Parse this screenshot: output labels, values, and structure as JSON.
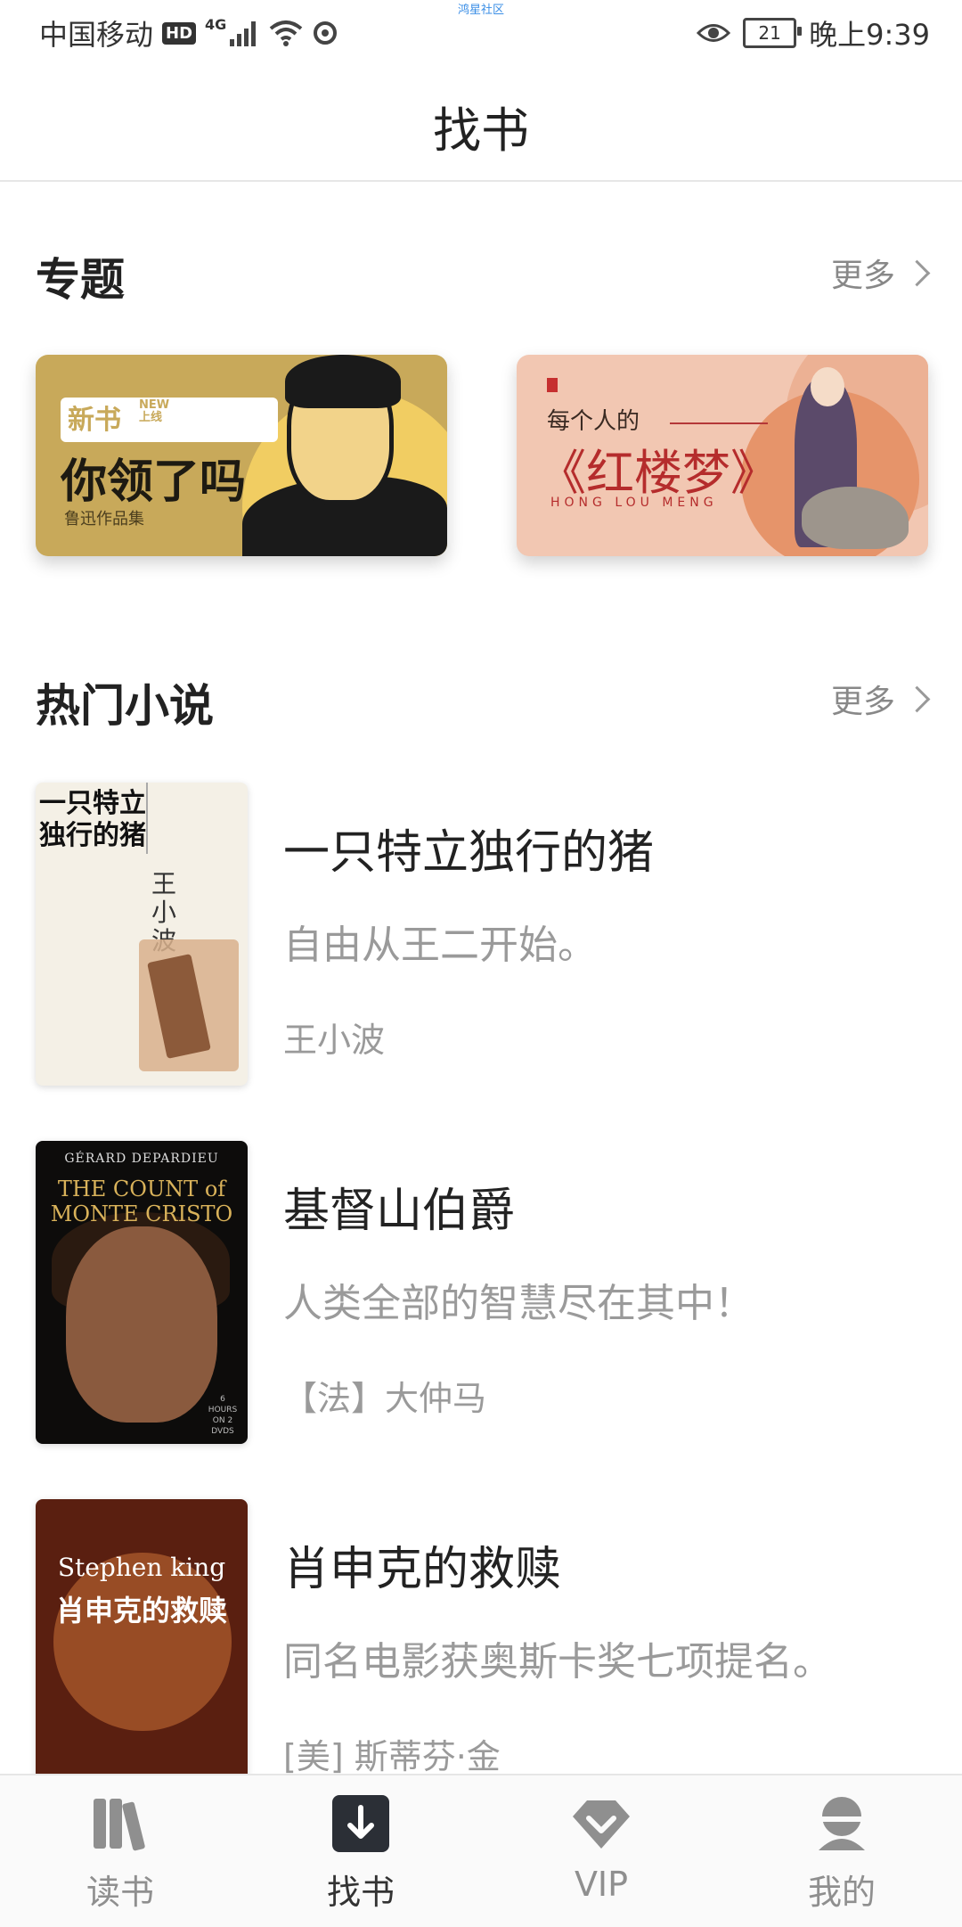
{
  "status_bar": {
    "carrier": "中国移动",
    "hd": "HD",
    "network": "4G",
    "center_text": "鸿星社区",
    "battery": "21",
    "time": "晚上9:39"
  },
  "header": {
    "title": "找书"
  },
  "topics": {
    "title": "专题",
    "more": "更多",
    "banners": [
      {
        "tag_big": "新书",
        "tag_small": "NEW\n上线",
        "main": "你领了吗",
        "sub": "鲁迅作品集"
      },
      {
        "line1": "每个人的",
        "main": "《红楼梦》",
        "pinyin": "HONG LOU MENG"
      }
    ]
  },
  "hot": {
    "title": "热门小说",
    "more": "更多",
    "books": [
      {
        "title": "一只特立独行的猪",
        "desc": "自由从王二开始。",
        "author": "王小波",
        "cover": {
          "title": "一只特立独行的猪",
          "author": "王小波"
        }
      },
      {
        "title": "基督山伯爵",
        "desc": "人类全部的智慧尽在其中！",
        "author": "【法】大仲马",
        "cover": {
          "name": "GÉRARD DEPARDIEU",
          "title": "THE COUNT of MONTE CRISTO",
          "foot": "6 HOURS ON 2 DVDS"
        }
      },
      {
        "title": "肖申克的救赎",
        "desc": "同名电影获奥斯卡奖七项提名。",
        "author": "[美] 斯蒂芬·金",
        "cover": {
          "author": "Stephen king",
          "title": "肖申克的救赎"
        }
      }
    ]
  },
  "nav": {
    "items": [
      {
        "label": "读书",
        "icon": "bookshelf-icon"
      },
      {
        "label": "找书",
        "icon": "find-book-icon"
      },
      {
        "label": "VIP",
        "icon": "vip-diamond-icon"
      },
      {
        "label": "我的",
        "icon": "profile-icon"
      }
    ],
    "active": "找书"
  }
}
